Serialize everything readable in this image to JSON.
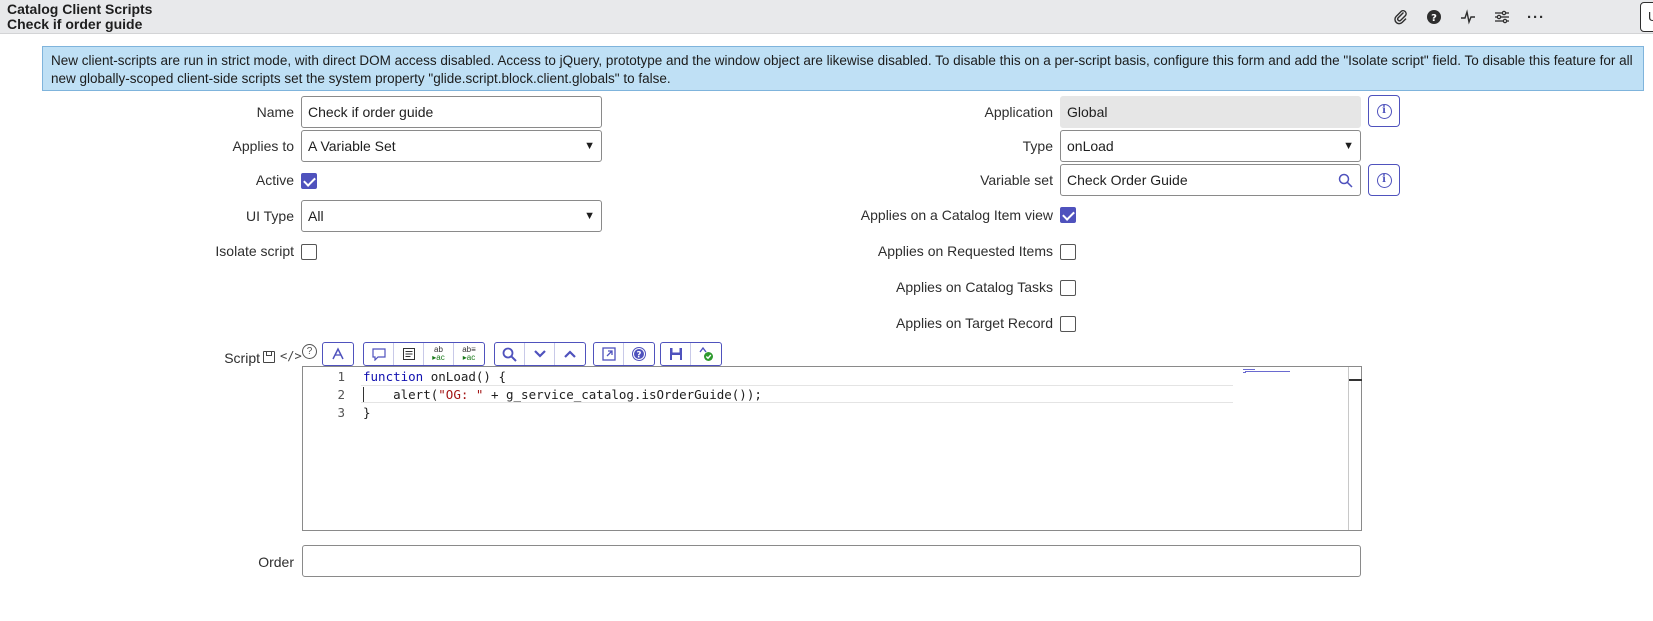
{
  "header": {
    "title": "Catalog Client Scripts",
    "subtitle": "Check if order guide",
    "icons": [
      "paperclip-icon",
      "help-icon",
      "activity-icon",
      "settings-sliders-icon",
      "more-icon"
    ],
    "edge_button_label": "U"
  },
  "banner": {
    "text": "New client-scripts are run in strict mode, with direct DOM access disabled. Access to jQuery, prototype and the window object are likewise disabled. To disable this on a per-script basis, configure this form and add the \"Isolate script\" field. To disable this feature for all new globally-scoped client-side scripts set the system property \"glide.script.block.client.globals\" to false."
  },
  "form": {
    "name": {
      "label": "Name",
      "value": "Check if order guide"
    },
    "applies_to": {
      "label": "Applies to",
      "value": "A Variable Set"
    },
    "active": {
      "label": "Active",
      "checked": true
    },
    "ui_type": {
      "label": "UI Type",
      "value": "All"
    },
    "isolate_script": {
      "label": "Isolate script",
      "checked": false
    },
    "application": {
      "label": "Application",
      "value": "Global"
    },
    "type": {
      "label": "Type",
      "value": "onLoad"
    },
    "variable_set": {
      "label": "Variable set",
      "value": "Check Order Guide"
    },
    "applies_catalog_item": {
      "label": "Applies on a Catalog Item view",
      "checked": true
    },
    "applies_requested_items": {
      "label": "Applies on Requested Items",
      "checked": false
    },
    "applies_catalog_tasks": {
      "label": "Applies on Catalog Tasks",
      "checked": false
    },
    "applies_target_record": {
      "label": "Applies on Target Record",
      "checked": false
    },
    "script": {
      "label": "Script",
      "line_numbers": [
        "1",
        "2",
        "3"
      ],
      "lines": [
        {
          "kw": "function",
          "rest": " onLoad() {"
        },
        {
          "pre": "    alert(",
          "str": "\"OG: \"",
          "post": " + g_service_catalog.isOrderGuide());"
        },
        {
          "text": "}"
        }
      ]
    },
    "order": {
      "label": "Order",
      "value": ""
    }
  },
  "toolbar": {
    "buttons": [
      "format-code-icon",
      "comment-icon",
      "format-icon",
      "replace-icon",
      "replace-all-icon",
      "search-icon",
      "fold-down-icon",
      "fold-up-icon",
      "fullscreen-icon",
      "help-icon",
      "save-icon",
      "syntax-check-icon"
    ]
  },
  "colors": {
    "accent": "#4f52bd",
    "banner_bg": "#bfe0f5",
    "header_bg": "#e8e9eb"
  }
}
